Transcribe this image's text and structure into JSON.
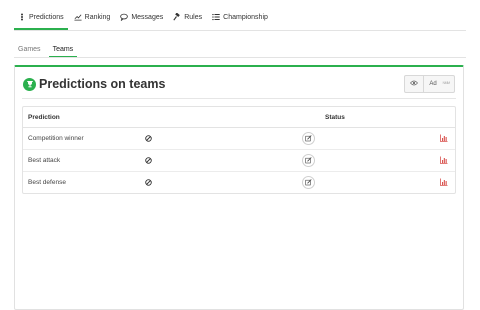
{
  "nav": {
    "items": [
      {
        "label": "Predictions",
        "icon": "ticket-icon",
        "active": true
      },
      {
        "label": "Ranking",
        "icon": "chart-line-icon",
        "active": false
      },
      {
        "label": "Messages",
        "icon": "chat-icon",
        "active": false
      },
      {
        "label": "Rules",
        "icon": "gavel-icon",
        "active": false
      },
      {
        "label": "Championship",
        "icon": "list-icon",
        "active": false
      }
    ]
  },
  "subtabs": {
    "items": [
      {
        "label": "Games",
        "active": false
      },
      {
        "label": "Teams",
        "active": true
      }
    ]
  },
  "panel": {
    "title": "Predictions on teams",
    "tools": {
      "ad": "Ad",
      "faint": "ᴺᴹᴹ"
    },
    "table": {
      "headers": {
        "prediction": "Prediction",
        "status": "Status"
      },
      "rows": [
        {
          "name": "Competition winner"
        },
        {
          "name": "Best attack"
        },
        {
          "name": "Best defense"
        }
      ]
    }
  },
  "colors": {
    "accent": "#2bb04e",
    "stats": "#d9534f"
  }
}
